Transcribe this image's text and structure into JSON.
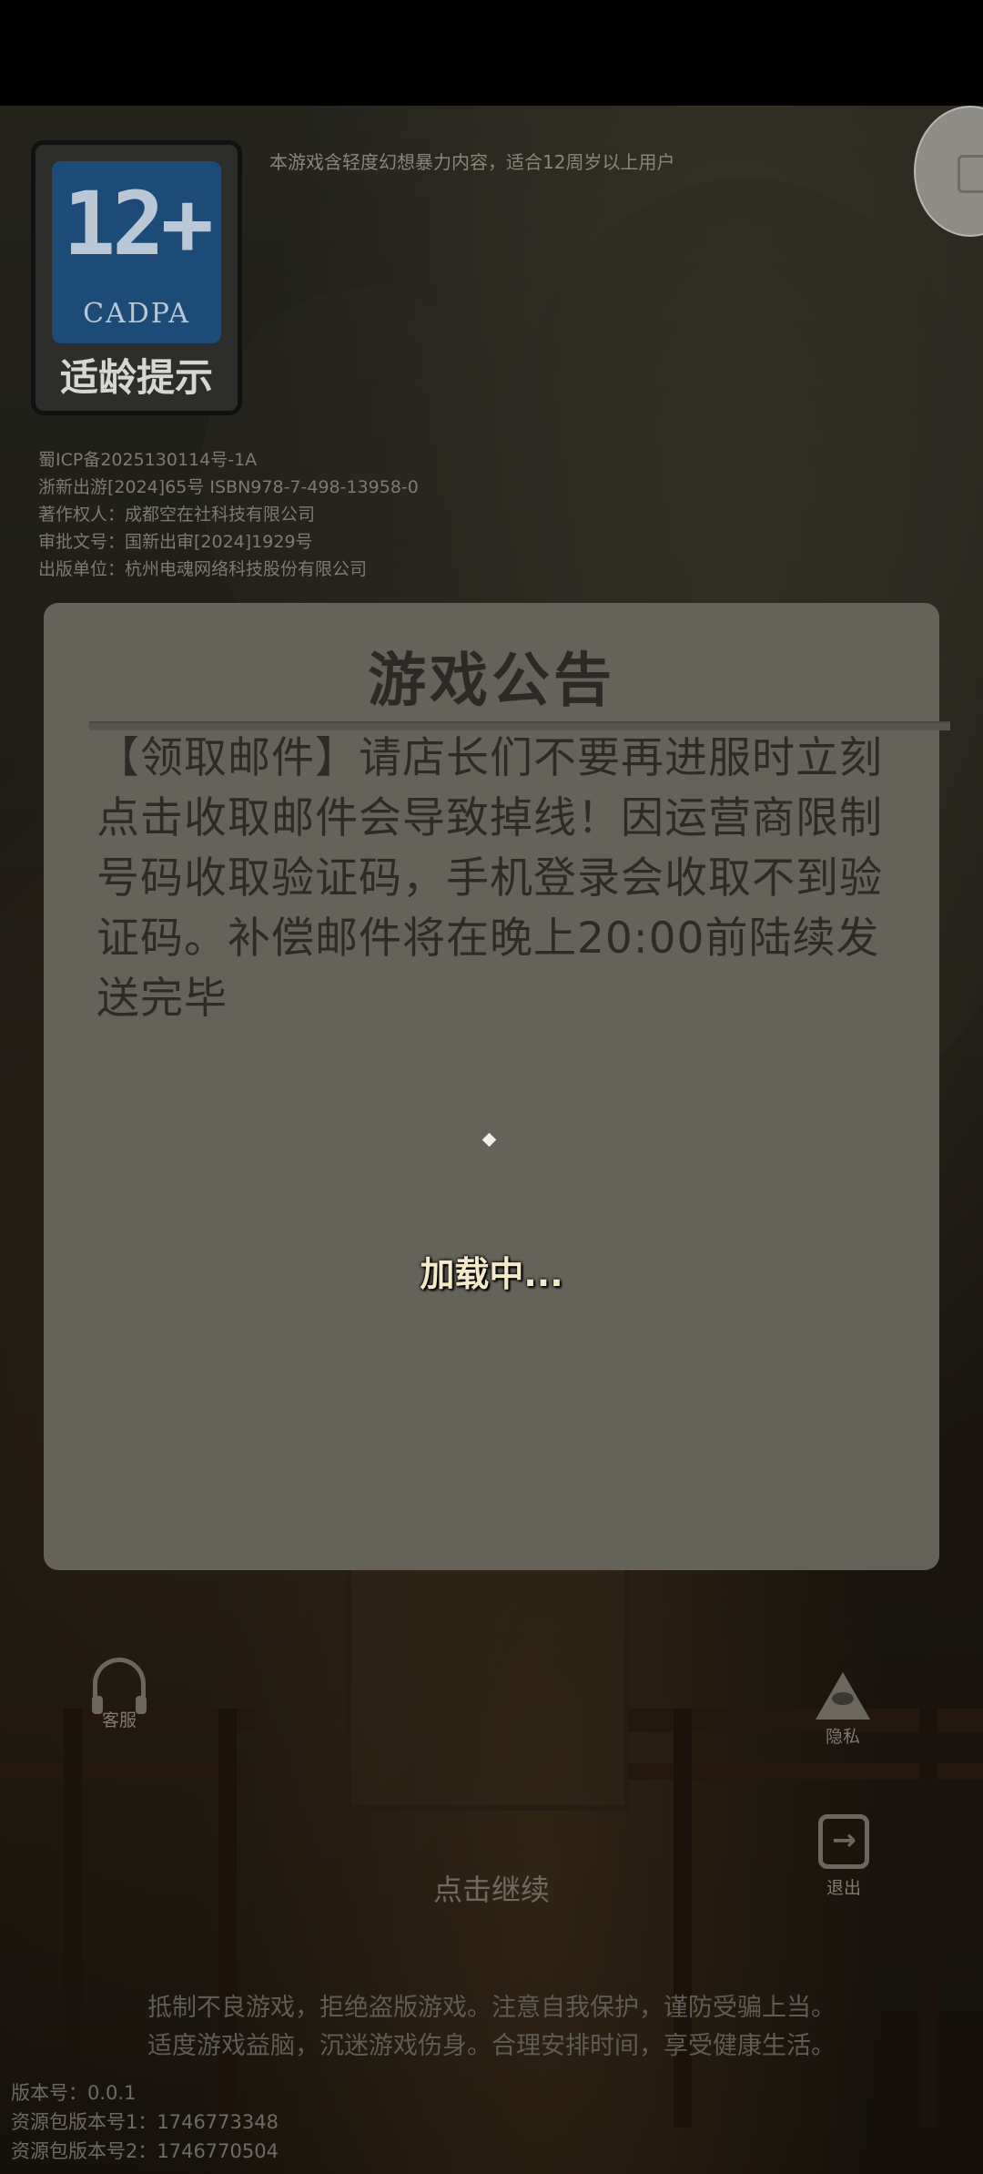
{
  "age_rating": {
    "number": "12+",
    "org": "CADPA",
    "label": "适龄提示"
  },
  "content_rating_text": "本游戏含轻度幻想暴力内容，适合12周岁以上用户",
  "license_lines": [
    "蜀ICP备2025130114号-1A",
    "浙新出游[2024]65号 ISBN978-7-498-13958-0",
    "著作权人：成都空在社科技有限公司",
    "审批文号：国新出审[2024]1929号",
    "出版单位：杭州电魂网络科技股份有限公司"
  ],
  "notice": {
    "title": "游戏公告",
    "body": "【领取邮件】请店长们不要再进服时立刻点击收取邮件会导致掉线！因运营商限制号码收取验证码，手机登录会收取不到验证码。补偿邮件将在晚上20:00前陆续发送完毕",
    "loading_text": "加载中..."
  },
  "controls": {
    "support_label": "客服",
    "privacy_label": "隐私",
    "exit_label": "退出",
    "tap_continue": "点击继续"
  },
  "health_notice": [
    "抵制不良游戏，拒绝盗版游戏。注意自我保护，谨防受骗上当。",
    "适度游戏益脑，沉迷游戏伤身。合理安排时间，享受健康生活。"
  ],
  "version": {
    "app_version": "版本号：0.0.1",
    "res_version_1": "资源包版本号1：1746773348",
    "res_version_2": "资源包版本号2：1746770504"
  }
}
